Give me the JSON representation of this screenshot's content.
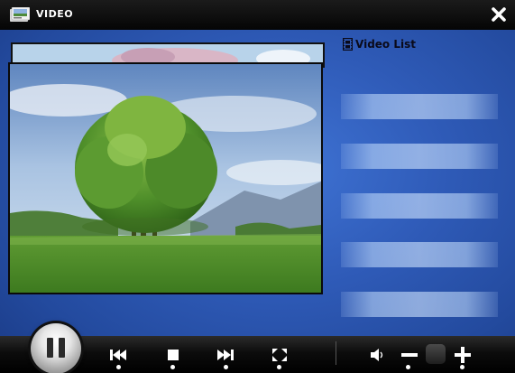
{
  "window": {
    "title": "VIDEO"
  },
  "video_list": {
    "header": "Video List",
    "slots": [
      "",
      "",
      "",
      "",
      ""
    ]
  },
  "controls": {
    "pause": "pause-icon",
    "previous": "skip-previous-icon",
    "stop": "stop-icon",
    "next": "skip-next-icon",
    "fullscreen": "fullscreen-icon",
    "volume": "speaker-icon",
    "volume_down": "minus-icon",
    "volume_up": "plus-icon"
  },
  "colors": {
    "background": "#2f5bb8",
    "bar": "#0c0c0c",
    "accent": "#ffffff"
  }
}
